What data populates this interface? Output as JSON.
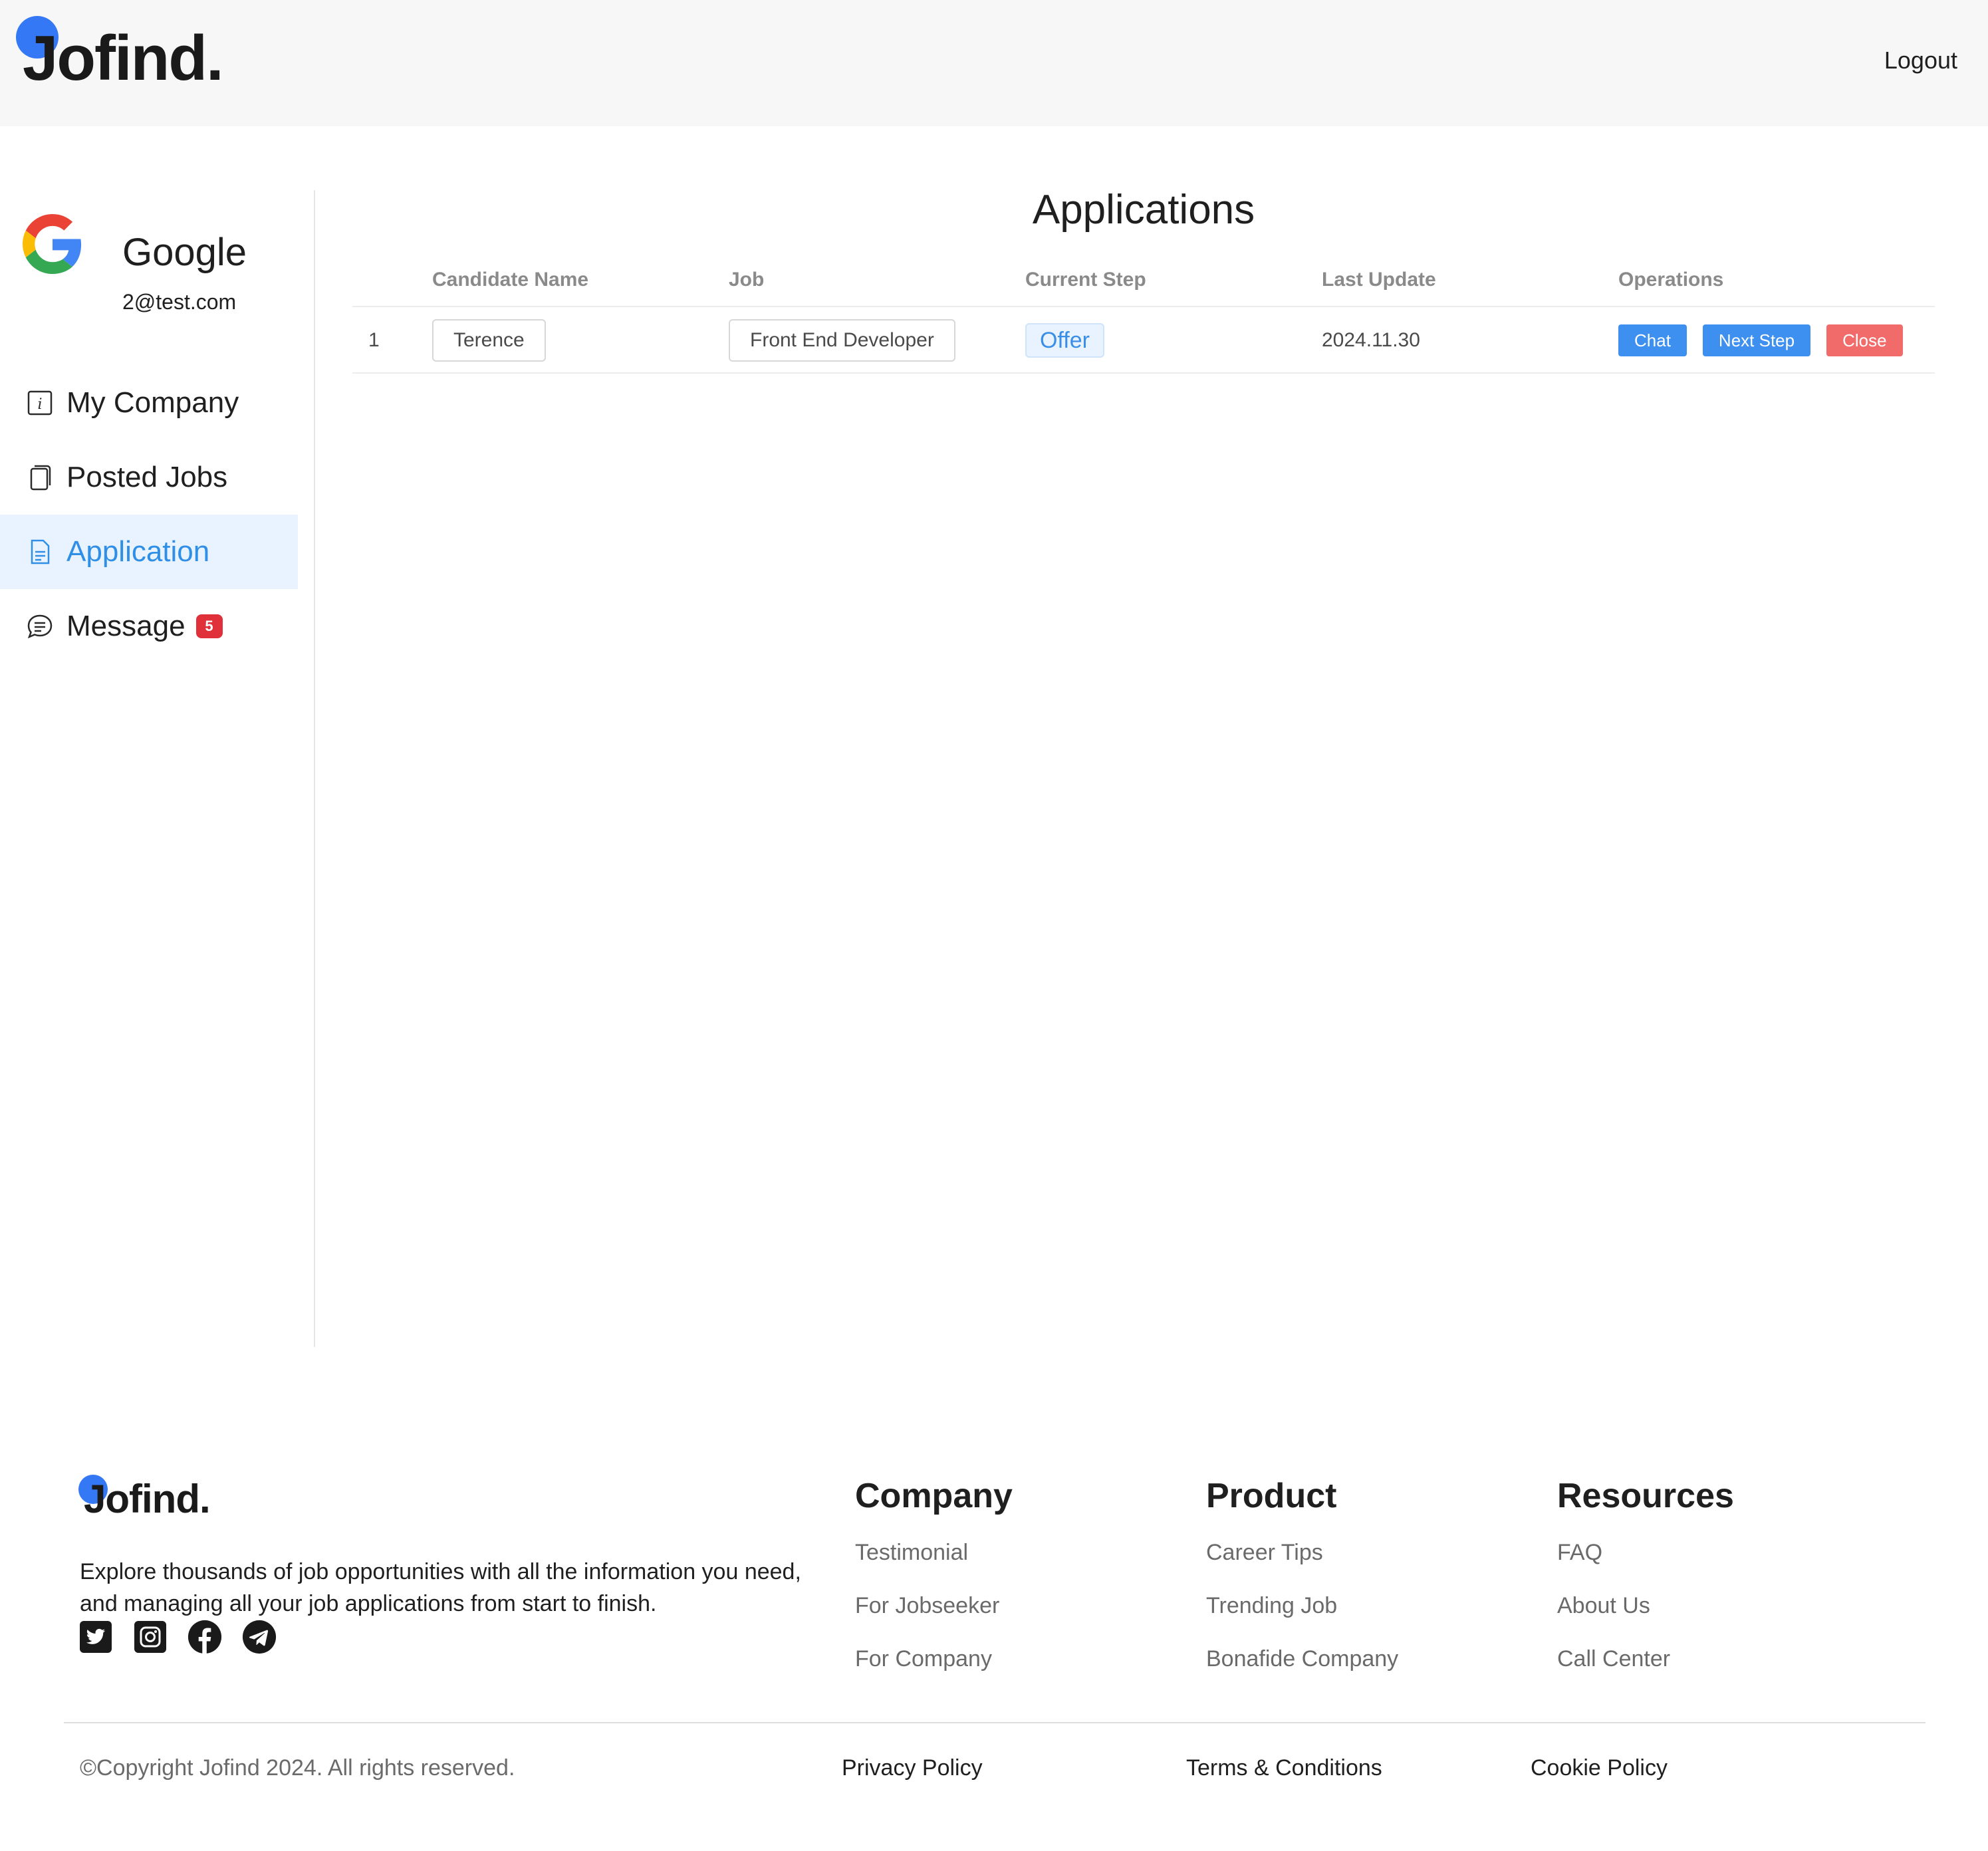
{
  "header": {
    "logo_text": "Jofind.",
    "logout_label": "Logout"
  },
  "sidebar": {
    "company_name": "Google",
    "company_email": "2@test.com",
    "items": [
      {
        "label": "My Company",
        "icon": "info-icon"
      },
      {
        "label": "Posted Jobs",
        "icon": "copy-icon"
      },
      {
        "label": "Application",
        "icon": "document-icon",
        "active": true
      },
      {
        "label": "Message",
        "icon": "chat-bubble-icon",
        "badge": "5"
      }
    ]
  },
  "main": {
    "title": "Applications",
    "columns": [
      "Candidate Name",
      "Job",
      "Current Step",
      "Last Update",
      "Operations"
    ],
    "rows": [
      {
        "index": "1",
        "candidate": "Terence",
        "job": "Front End Developer",
        "step": "Offer",
        "last_update": "2024.11.30",
        "ops": {
          "chat": "Chat",
          "next": "Next Step",
          "close": "Close"
        }
      }
    ]
  },
  "footer": {
    "logo_text": "Jofind.",
    "description": "Explore thousands of job opportunities with all the information you need, and managing all your job applications from start to finish.",
    "socials": [
      "twitter-icon",
      "instagram-icon",
      "facebook-icon",
      "telegram-icon"
    ],
    "columns": [
      {
        "title": "Company",
        "links": [
          "Testimonial",
          "For Jobseeker",
          "For Company"
        ]
      },
      {
        "title": "Product",
        "links": [
          "Career Tips",
          "Trending Job",
          "Bonafide Company"
        ]
      },
      {
        "title": "Resources",
        "links": [
          "FAQ",
          "About Us",
          "Call Center"
        ]
      }
    ],
    "copyright": "©Copyright Jofind 2024. All rights reserved.",
    "bottom_links": [
      "Privacy Policy",
      "Terms & Conditions",
      "Cookie Policy"
    ]
  },
  "colors": {
    "brand": "#3478f6",
    "accent": "#2f8fe6",
    "danger": "#f16b6b",
    "badge": "#e0303a"
  }
}
